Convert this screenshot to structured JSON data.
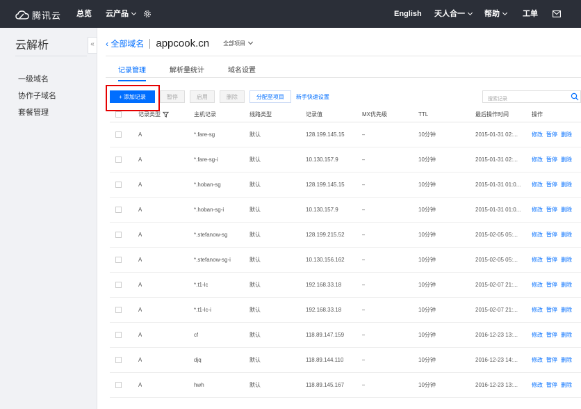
{
  "topbar": {
    "logo_text": "腾讯云",
    "overview": "总览",
    "products": "云产品",
    "language": "English",
    "account": "天人合一",
    "help": "帮助",
    "ticket": "工单",
    "gear_icon": "gear-icon",
    "mail_icon": "mail-icon"
  },
  "sidebar": {
    "title": "云解析",
    "items": [
      "一级域名",
      "协作子域名",
      "套餐管理"
    ],
    "collapse_label": "«"
  },
  "breadcrumb": {
    "back": "全部域名",
    "domain": "appcook.cn",
    "project": "全部项目"
  },
  "tabs": [
    "记录管理",
    "解析量统计",
    "域名设置"
  ],
  "toolbar": {
    "add": "+ 添加记录",
    "pause": "暂停",
    "enable": "启用",
    "delete": "删除",
    "assign": "分配至项目",
    "quick_setup": "新手快速设置"
  },
  "search": {
    "placeholder": "搜索记录"
  },
  "table": {
    "headers": [
      "记录类型",
      "主机记录",
      "线路类型",
      "记录值",
      "MX优先级",
      "TTL",
      "最后操作时间",
      "操作"
    ],
    "ops": [
      "修改",
      "暂停",
      "删除"
    ],
    "rows": [
      {
        "type": "A",
        "host": "*.fare-sg",
        "line": "默认",
        "value": "128.199.145.15",
        "mx": "–",
        "ttl": "10分钟",
        "time": "2015-01-31 02:..."
      },
      {
        "type": "A",
        "host": "*.fare-sg-i",
        "line": "默认",
        "value": "10.130.157.9",
        "mx": "–",
        "ttl": "10分钟",
        "time": "2015-01-31 02:..."
      },
      {
        "type": "A",
        "host": "*.hoban-sg",
        "line": "默认",
        "value": "128.199.145.15",
        "mx": "–",
        "ttl": "10分钟",
        "time": "2015-01-31 01:0..."
      },
      {
        "type": "A",
        "host": "*.hoban-sg-i",
        "line": "默认",
        "value": "10.130.157.9",
        "mx": "–",
        "ttl": "10分钟",
        "time": "2015-01-31 01:0..."
      },
      {
        "type": "A",
        "host": "*.stefanow-sg",
        "line": "默认",
        "value": "128.199.215.52",
        "mx": "–",
        "ttl": "10分钟",
        "time": "2015-02-05 05:..."
      },
      {
        "type": "A",
        "host": "*.stefanow-sg-i",
        "line": "默认",
        "value": "10.130.156.162",
        "mx": "–",
        "ttl": "10分钟",
        "time": "2015-02-05 05:..."
      },
      {
        "type": "A",
        "host": "*.t1-lc",
        "line": "默认",
        "value": "192.168.33.18",
        "mx": "–",
        "ttl": "10分钟",
        "time": "2015-02-07 21:..."
      },
      {
        "type": "A",
        "host": "*.t1-lc-i",
        "line": "默认",
        "value": "192.168.33.18",
        "mx": "–",
        "ttl": "10分钟",
        "time": "2015-02-07 21:..."
      },
      {
        "type": "A",
        "host": "cf",
        "line": "默认",
        "value": "118.89.147.159",
        "mx": "–",
        "ttl": "10分钟",
        "time": "2016-12-23 13:..."
      },
      {
        "type": "A",
        "host": "djq",
        "line": "默认",
        "value": "118.89.144.110",
        "mx": "–",
        "ttl": "10分钟",
        "time": "2016-12-23 14:..."
      },
      {
        "type": "A",
        "host": "hwh",
        "line": "默认",
        "value": "118.89.145.167",
        "mx": "–",
        "ttl": "10分钟",
        "time": "2016-12-23 13:..."
      }
    ]
  },
  "colors": {
    "topbar_bg": "#2b2f38",
    "accent": "#006eff",
    "highlight_border": "#e50000",
    "sidebar_bg": "#f1f2f5"
  }
}
